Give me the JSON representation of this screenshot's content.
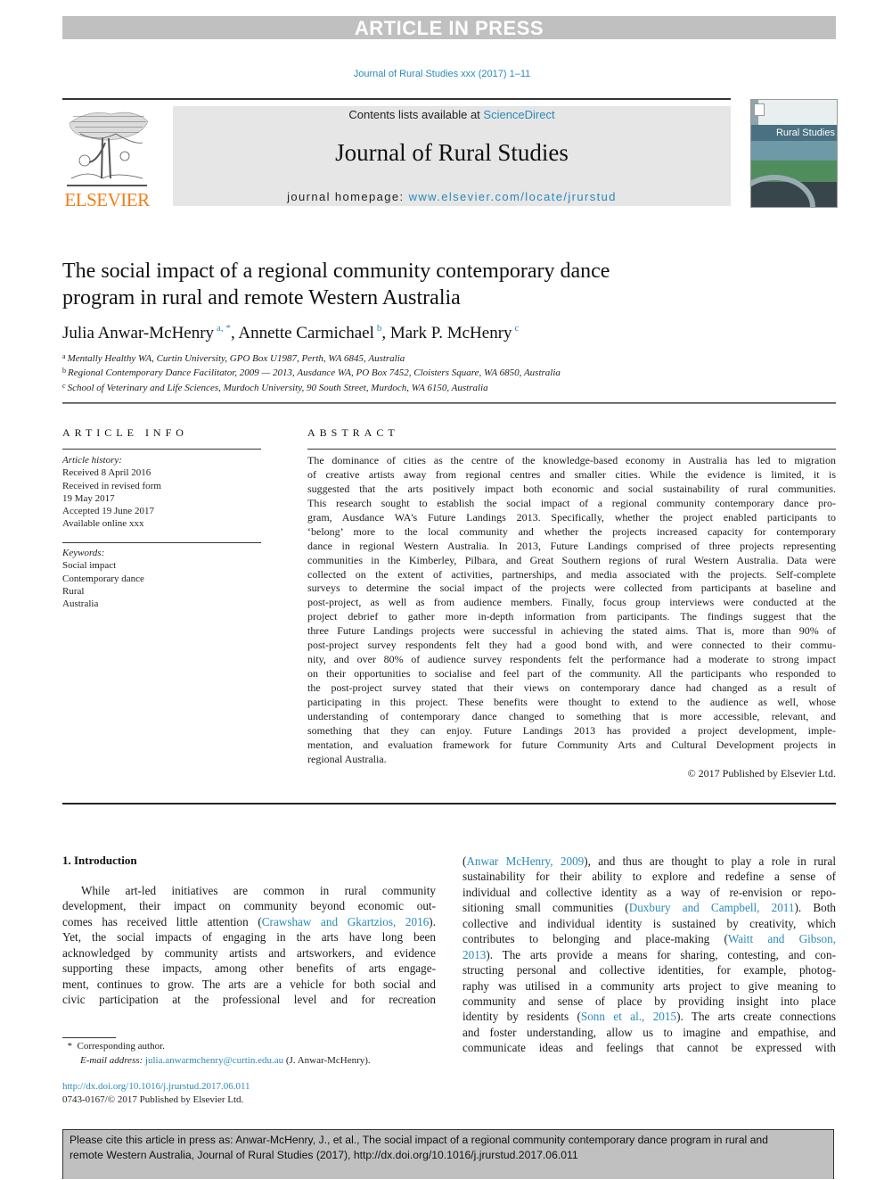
{
  "banner": "ARTICLE IN PRESS",
  "journal_ref": "Journal of Rural Studies xxx (2017) 1–11",
  "header": {
    "contents_prefix": "Contents lists available at ",
    "contents_link": "ScienceDirect",
    "journal_name": "Journal of Rural Studies",
    "homepage_prefix": "journal homepage: ",
    "homepage_link": "www.elsevier.com/locate/jrurstud",
    "publisher_logo_text": "ELSEVIER",
    "cover_title": "Rural Studies"
  },
  "article": {
    "title_line1": "The social impact of a regional community contemporary dance",
    "title_line2": "program in rural and remote Western Australia",
    "authors": [
      {
        "name": "Julia Anwar-McHenry",
        "sup": "a, *",
        "sep": ", "
      },
      {
        "name": "Annette Carmichael",
        "sup": "b",
        "sep": ", "
      },
      {
        "name": "Mark P. McHenry",
        "sup": "c",
        "sep": ""
      }
    ],
    "affiliations": [
      {
        "key": "a",
        "text": "Mentally Healthy WA, Curtin University, GPO Box U1987, Perth, WA 6845, Australia"
      },
      {
        "key": "b",
        "text": "Regional Contemporary Dance Facilitator, 2009 — 2013, Ausdance WA, PO Box 7452, Cloisters Square, WA 6850, Australia"
      },
      {
        "key": "c",
        "text": "School of Veterinary and Life Sciences, Murdoch University, 90 South Street, Murdoch, WA 6150, Australia"
      }
    ]
  },
  "article_info": {
    "heading": "ARTICLE INFO",
    "history_label": "Article history:",
    "history": [
      "Received 8 April 2016",
      "Received in revised form",
      "19 May 2017",
      "Accepted 19 June 2017",
      "Available online xxx"
    ],
    "keywords_label": "Keywords:",
    "keywords": [
      "Social impact",
      "Contemporary dance",
      "Rural",
      "Australia"
    ]
  },
  "abstract": {
    "heading": "ABSTRACT",
    "lines": [
      "The dominance of cities as the centre of the knowledge-based economy in Australia has led to migration",
      "of creative artists away from regional centres and smaller cities. While the evidence is limited, it is",
      "suggested that the arts positively impact both economic and social sustainability of rural communities.",
      "This research sought to establish the social impact of a regional community contemporary dance pro-",
      "gram, Ausdance WA's Future Landings 2013. Specifically, whether the project enabled participants to",
      "‘belong’ more to the local community and whether the projects increased capacity for contemporary",
      "dance in regional Western Australia. In 2013, Future Landings comprised of three projects representing",
      "communities in the Kimberley, Pilbara, and Great Southern regions of rural Western Australia. Data were",
      "collected on the extent of activities, partnerships, and media associated with the projects. Self-complete",
      "surveys to determine the social impact of the projects were collected from participants at baseline and",
      "post-project, as well as from audience members. Finally, focus group interviews were conducted at the",
      "project debrief to gather more in-depth information from participants. The findings suggest that the",
      "three Future Landings projects were successful in achieving the stated aims. That is, more than 90% of",
      "post-project survey respondents felt they had a good bond with, and were connected to their commu-",
      "nity, and over 80% of audience survey respondents felt the performance had a moderate to strong impact",
      "on their opportunities to socialise and feel part of the community. All the participants who responded to",
      "the post-project survey stated that their views on contemporary dance had changed as a result of",
      "participating in this project. These benefits were thought to extend to the audience as well, whose",
      "understanding of contemporary dance changed to something that is more accessible, relevant, and",
      "something that they can enjoy. Future Landings 2013 has provided a project development, imple-",
      "mentation, and evaluation framework for future Community Arts and Cultural Development projects in",
      "regional Australia."
    ],
    "copyright": "© 2017 Published by Elsevier Ltd."
  },
  "introduction": {
    "heading": "1.  Introduction",
    "left_lines": [
      {
        "parts": [
          {
            "t": "While art-led initiatives are common in rural community"
          }
        ]
      },
      {
        "parts": [
          {
            "t": "development, their impact on community beyond economic out-"
          }
        ]
      },
      {
        "parts": [
          {
            "t": "comes has received little attention ("
          },
          {
            "t": "Crawshaw and Gkartzios, 2016",
            "link": true
          },
          {
            "t": ")."
          }
        ]
      },
      {
        "parts": [
          {
            "t": "Yet, the social impacts of engaging in the arts have long been"
          }
        ]
      },
      {
        "parts": [
          {
            "t": "acknowledged by community artists and artsworkers, and evidence"
          }
        ]
      },
      {
        "parts": [
          {
            "t": "supporting these impacts, among other benefits of arts engage-"
          }
        ]
      },
      {
        "parts": [
          {
            "t": "ment, continues to grow. The arts are a vehicle for both social and"
          }
        ]
      },
      {
        "parts": [
          {
            "t": "civic participation at the professional level and for recreation"
          }
        ]
      }
    ],
    "right_lines": [
      {
        "parts": [
          {
            "t": "("
          },
          {
            "t": "Anwar McHenry, 2009",
            "link": true
          },
          {
            "t": "), and thus are thought to play a role in rural"
          }
        ]
      },
      {
        "parts": [
          {
            "t": "sustainability for their ability to explore and redefine a sense of"
          }
        ]
      },
      {
        "parts": [
          {
            "t": "individual and collective identity as a way of re-envision or repo-"
          }
        ]
      },
      {
        "parts": [
          {
            "t": "sitioning small communities ("
          },
          {
            "t": "Duxbury and Campbell, 2011",
            "link": true
          },
          {
            "t": "). Both"
          }
        ]
      },
      {
        "parts": [
          {
            "t": "collective and individual identity is sustained by creativity, which"
          }
        ]
      },
      {
        "parts": [
          {
            "t": "contributes to belonging and place-making ("
          },
          {
            "t": "Waitt and Gibson,",
            "link": true
          }
        ]
      },
      {
        "parts": [
          {
            "t": "2013",
            "link": true
          },
          {
            "t": "). The arts provide a means for sharing, contesting, and con-"
          }
        ]
      },
      {
        "parts": [
          {
            "t": "structing personal and collective identities, for example, photog-"
          }
        ]
      },
      {
        "parts": [
          {
            "t": "raphy was utilised in a community arts project to give meaning to"
          }
        ]
      },
      {
        "parts": [
          {
            "t": "community and sense of place by providing insight into place"
          }
        ]
      },
      {
        "parts": [
          {
            "t": "identity by residents ("
          },
          {
            "t": "Sonn et al., 2015",
            "link": true
          },
          {
            "t": "). The arts create connections"
          }
        ]
      },
      {
        "parts": [
          {
            "t": "and foster understanding, allow us to imagine and empathise, and"
          }
        ]
      },
      {
        "parts": [
          {
            "t": "communicate ideas and feelings that cannot be expressed with"
          }
        ]
      }
    ]
  },
  "footnote": {
    "marker": "*",
    "corresponding": "Corresponding author.",
    "email_label": "E-mail address:",
    "email": "julia.anwarmchenry@curtin.edu.au",
    "email_suffix": "(J. Anwar-McHenry)."
  },
  "doi": {
    "link": "http://dx.doi.org/10.1016/j.jrurstud.2017.06.011",
    "issn_line": "0743-0167/© 2017 Published by Elsevier Ltd."
  },
  "citation_box": {
    "line1": "Please cite this article in press as: Anwar-McHenry, J., et al., The social impact of a regional community contemporary dance program in rural and",
    "line2": "remote Western Australia, Journal of Rural Studies (2017), http://dx.doi.org/10.1016/j.jrurstud.2017.06.011"
  },
  "colors": {
    "link": "#2a8ab8",
    "elsevier_orange": "#f07f1b",
    "banner_gray": "#c0c0c0",
    "header_gray": "#e6e6e6"
  }
}
